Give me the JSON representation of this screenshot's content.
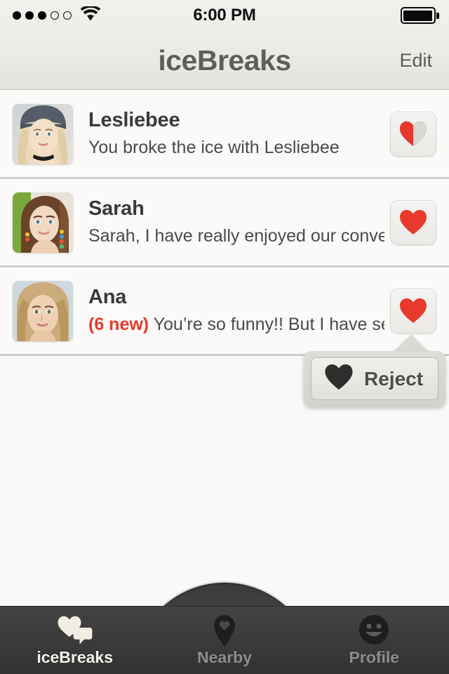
{
  "status_bar": {
    "signal_icon": "signal-dots-icon",
    "signal_dots_filled": 3,
    "signal_dots_total": 5,
    "wifi_icon": "wifi-icon",
    "time": "6:00 PM",
    "battery_icon": "battery-full-icon",
    "battery_level": 100
  },
  "navbar": {
    "title": "iceBreaks",
    "edit_label": "Edit"
  },
  "list": {
    "rows": [
      {
        "name": "Lesliebee",
        "message": "You broke the ice with Lesliebee",
        "new_badge": "",
        "avatar_name": "avatar-lesliebee",
        "heart_icon": "heart-half-icon",
        "heart_state": "half"
      },
      {
        "name": "Sarah",
        "message": "Sarah, I have really enjoyed our conver...",
        "new_badge": "",
        "avatar_name": "avatar-sarah",
        "heart_icon": "heart-filled-icon",
        "heart_state": "full"
      },
      {
        "name": "Ana",
        "message": "You’re so funny!! But I have sen...",
        "new_badge": "(6 new)",
        "avatar_name": "avatar-ana",
        "heart_icon": "heart-filled-icon",
        "heart_state": "full"
      }
    ]
  },
  "popover": {
    "label": "Reject",
    "icon": "heart-dark-icon"
  },
  "tabbar": {
    "tabs": [
      {
        "label": "iceBreaks",
        "icon": "hearts-chat-icon",
        "active": true
      },
      {
        "label": "Nearby",
        "icon": "map-pin-heart-icon",
        "active": false
      },
      {
        "label": "Profile",
        "icon": "smiley-face-icon",
        "active": false
      }
    ]
  },
  "colors": {
    "heart_red": "#e8392f",
    "heart_grey": "#d9d7d2",
    "badge_red": "#e8392f",
    "background": "#faf9f7",
    "tabbar_dark": "#3c3c3b"
  }
}
